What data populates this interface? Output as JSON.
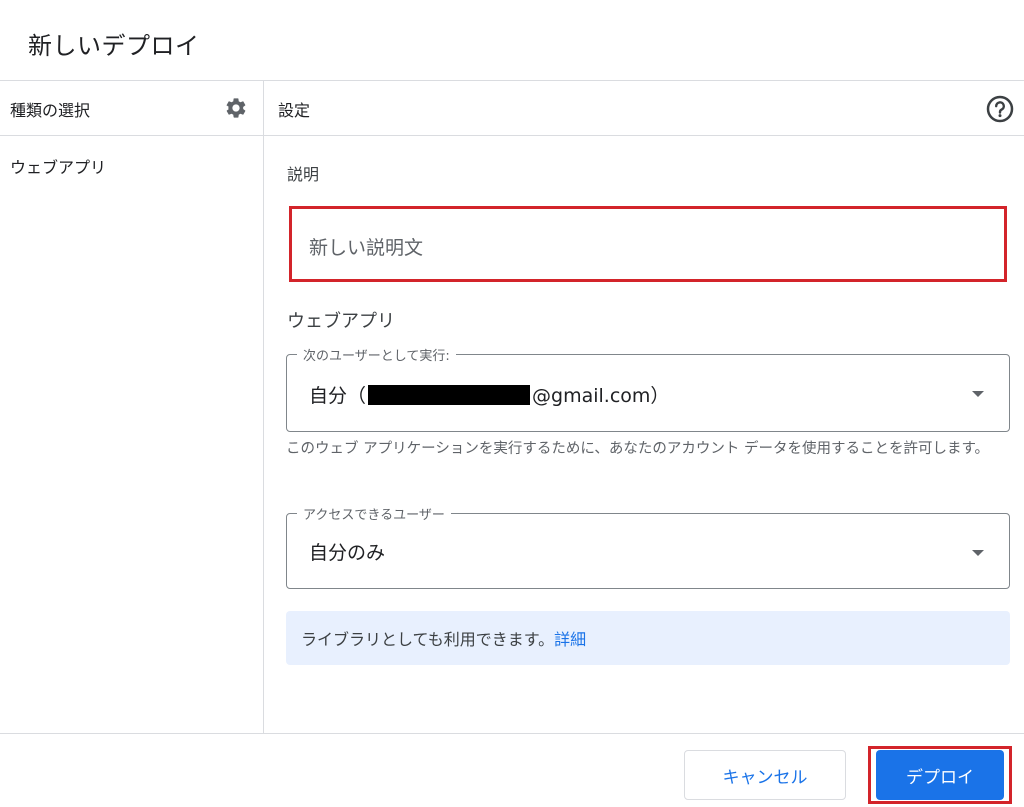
{
  "dialog": {
    "title": "新しいデプロイ"
  },
  "left_panel": {
    "header": "種類の選択",
    "header_icon": "gear-icon",
    "items": [
      {
        "label": "ウェブアプリ"
      }
    ]
  },
  "right_panel": {
    "header": "設定",
    "header_icon": "help-icon",
    "description": {
      "label": "説明",
      "value": "新しい説明文"
    },
    "webapp_section": {
      "title": "ウェブアプリ",
      "execute_as": {
        "legend": "次のユーザーとして実行:",
        "value_prefix": "自分（",
        "value_suffix": "@gmail.com）"
      },
      "hint": "このウェブ アプリケーションを実行するために、あなたのアカウント データを使用することを許可します。",
      "access": {
        "legend": "アクセスできるユーザー",
        "value": "自分のみ"
      },
      "banner": {
        "text": "ライブラリとしても利用できます。",
        "link": "詳細"
      }
    }
  },
  "footer": {
    "cancel_label": "キャンセル",
    "deploy_label": "デプロイ"
  },
  "colors": {
    "primary": "#1a73e8",
    "highlight": "#d3242a",
    "banner_bg": "#e8f0fe"
  }
}
